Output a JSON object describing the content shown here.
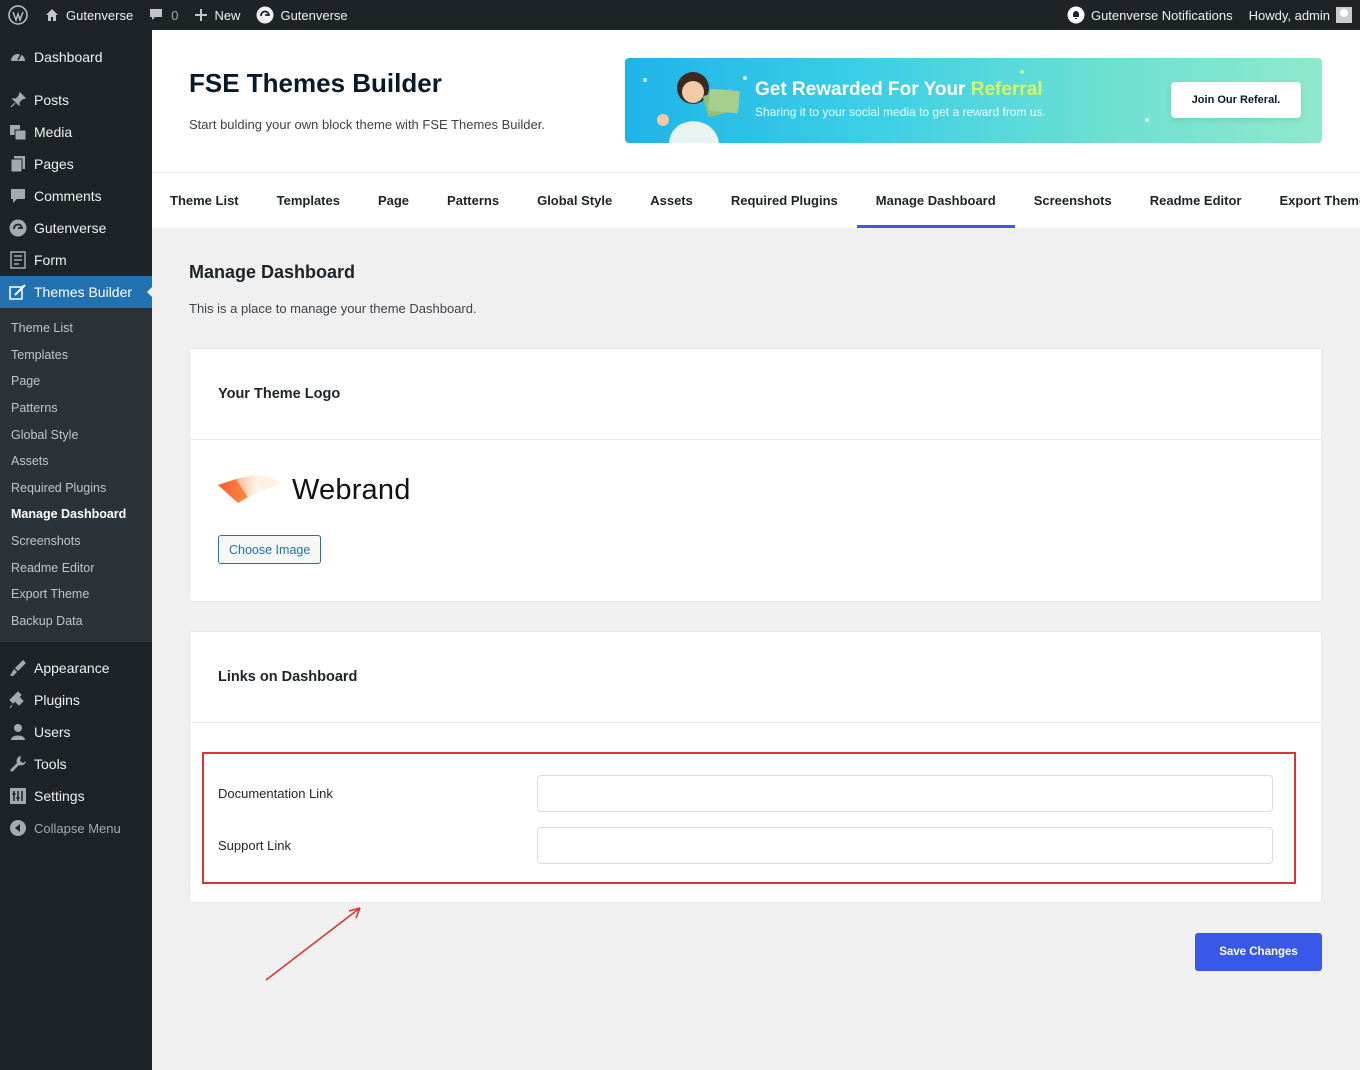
{
  "adminbar": {
    "site_name": "Gutenverse",
    "comments_count": "0",
    "new_label": "New",
    "plugin_label": "Gutenverse",
    "notifications_label": "Gutenverse Notifications",
    "howdy": "Howdy, admin"
  },
  "sidebar": {
    "top_items": [
      {
        "label": "Dashboard",
        "icon": "dashboard-icon"
      },
      {
        "label": "Posts",
        "icon": "pin-icon"
      },
      {
        "label": "Media",
        "icon": "media-icon"
      },
      {
        "label": "Pages",
        "icon": "pages-icon"
      },
      {
        "label": "Comments",
        "icon": "comment-icon"
      },
      {
        "label": "Gutenverse",
        "icon": "gutenverse-icon"
      },
      {
        "label": "Form",
        "icon": "form-icon"
      },
      {
        "label": "Themes Builder",
        "icon": "themes-builder-icon"
      }
    ],
    "submenu": [
      "Theme List",
      "Templates",
      "Page",
      "Patterns",
      "Global Style",
      "Assets",
      "Required Plugins",
      "Manage Dashboard",
      "Screenshots",
      "Readme Editor",
      "Export Theme",
      "Backup Data"
    ],
    "bottom_items": [
      {
        "label": "Appearance",
        "icon": "brush-icon"
      },
      {
        "label": "Plugins",
        "icon": "plugin-icon"
      },
      {
        "label": "Users",
        "icon": "user-icon"
      },
      {
        "label": "Tools",
        "icon": "wrench-icon"
      },
      {
        "label": "Settings",
        "icon": "settings-icon"
      }
    ],
    "collapse_label": "Collapse Menu"
  },
  "header": {
    "title": "FSE Themes Builder",
    "description": "Start bulding your own block theme with FSE Themes Builder."
  },
  "banner": {
    "title_main": "Get Rewarded For Your ",
    "title_highlight": "Referral",
    "subtitle": "Sharing it to your social media to get a reward from us.",
    "button_label": "Join Our Referal."
  },
  "tabs": [
    "Theme List",
    "Templates",
    "Page",
    "Patterns",
    "Global Style",
    "Assets",
    "Required Plugins",
    "Manage Dashboard",
    "Screenshots",
    "Readme Editor",
    "Export Theme"
  ],
  "active_tab": "Manage Dashboard",
  "content": {
    "title": "Manage Dashboard",
    "description": "This is a place to manage your theme Dashboard.",
    "logo_card": {
      "title": "Your Theme Logo",
      "logo_text": "Webrand",
      "choose_button": "Choose Image"
    },
    "links_card": {
      "title": "Links on Dashboard",
      "documentation_label": "Documentation Link",
      "documentation_value": "",
      "support_label": "Support Link",
      "support_value": ""
    },
    "save_button": "Save Changes"
  },
  "colors": {
    "accent": "#2271b1",
    "save_button": "#3858e9",
    "tab_underline": "#3b5bdb",
    "highlight_box": "#d63638"
  }
}
